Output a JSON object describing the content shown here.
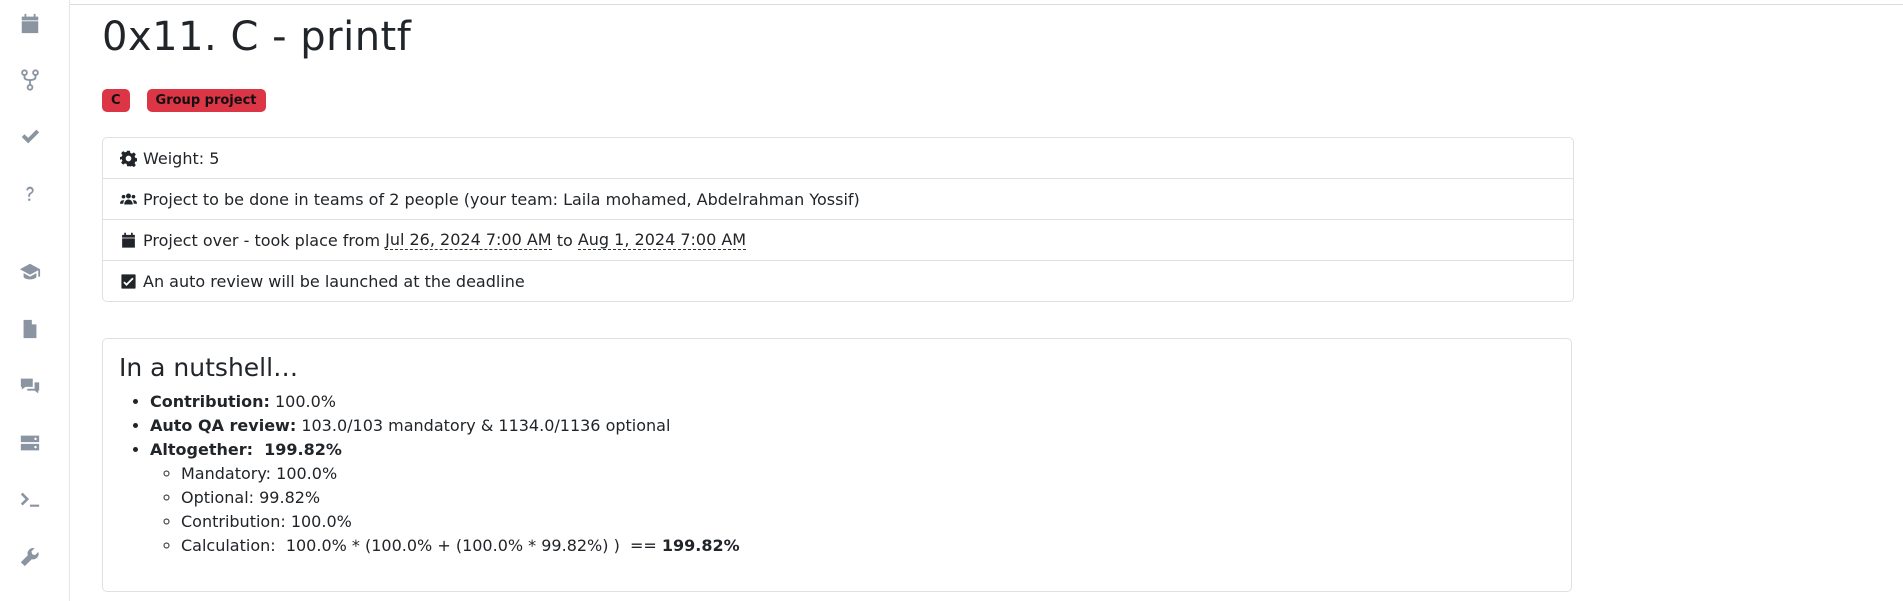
{
  "sidebar": {
    "icons": [
      "calendar-icon",
      "code-fork-icon",
      "check-icon",
      "question-icon",
      "graduation-cap-icon",
      "file-icon",
      "comments-icon",
      "server-icon",
      "terminal-icon",
      "wrench-icon"
    ]
  },
  "project": {
    "title": "0x11. C - printf",
    "badges": [
      "C",
      "Group project"
    ],
    "badge_color": "#dc3545"
  },
  "info": {
    "weight": "Weight: 5",
    "team": "Project to be done in teams of 2 people (your team: Laila mohamed, Abdelrahman Yossif)",
    "period_prefix": "Project over - took place from ",
    "start": "Jul 26, 2024 7:00 AM",
    "period_mid": " to ",
    "end": "Aug 1, 2024 7:00 AM",
    "auto_review": "An auto review will be launched at the deadline"
  },
  "nutshell": {
    "title": "In a nutshell…",
    "contribution_label": "Contribution:",
    "contribution_value": " 100.0%",
    "qa_label": "Auto QA review:",
    "qa_value": " 103.0/103 mandatory & 1134.0/1136 optional",
    "altogether_label": "Altogether:",
    "altogether_value": "199.82%",
    "mandatory": "Mandatory: 100.0%",
    "optional": "Optional: 99.82%",
    "contribution_sub": "Contribution: 100.0%",
    "calculation_text": "Calculation:  100.0% * (100.0% + (100.0% * 99.82%) )  == ",
    "calculation_result": "199.82%"
  }
}
